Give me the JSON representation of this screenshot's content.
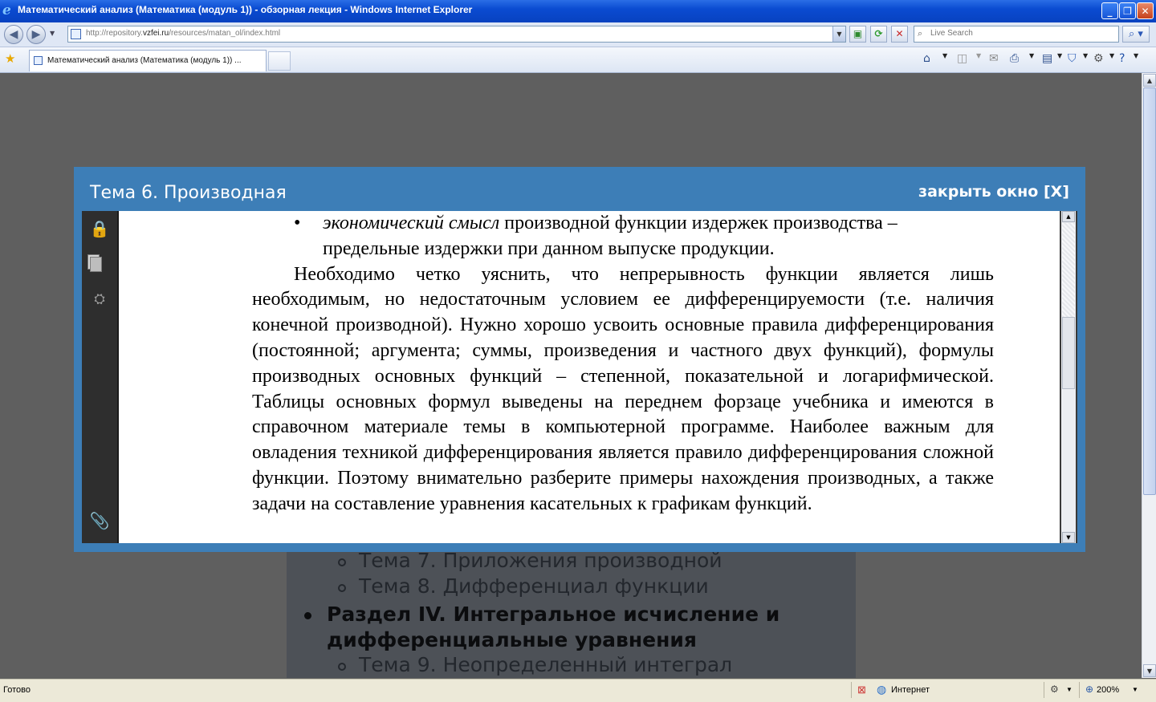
{
  "window": {
    "title": "Математический анализ (Математика (модуль 1)) - обзорная лекция - Windows Internet Explorer",
    "controls": {
      "minimize": "_",
      "maximize": "❐",
      "close": "✕"
    }
  },
  "navbar": {
    "url_prefix": "http://repository.",
    "url_domain": "vzfei.ru",
    "url_path": "/resources/matan_ol/index.html",
    "search_placeholder": "Live Search"
  },
  "tabs": [
    {
      "label": "Математический анализ (Математика (модуль 1)) ..."
    }
  ],
  "modal": {
    "title": "Тема 6. Производная",
    "close_label": "закрыть окно [X]",
    "bullet_italic": "экономический смысл",
    "bullet_text": " производной функции издержек производства – предельные издержки при данном выпуске продукции.",
    "paragraph": "Необходимо четко уяснить, что непрерывность функции является лишь необходимым, но недостаточным условием ее дифференцируемости (т.е. наличия конечной производной). Нужно хорошо усвоить основные правила дифференцирования (постоянной; аргумента; суммы, произведения и частного двух функций), формулы производных основных функций – степенной, показательной и логарифмической. Таблицы основных формул выведены на переднем форзаце учебника и имеются в справочном материале темы в компьютерной программе. Наиболее важным для овладения техникой дифференцирования является правило дифференцирования сложной функции. Поэтому внимательно разберите примеры нахождения производных, а также задачи на составление уравнения касательных к графикам функций."
  },
  "background_list": {
    "topic7": "Тема 7. Приложения производной",
    "topic8": "Тема 8. Дифференциал функции",
    "section4": "Раздел IV. Интегральное исчисление и дифференциальные уравнения",
    "topic9": "Тема 9. Неопределенный интеграл"
  },
  "status": {
    "text": "Готово",
    "zone": "Интернет",
    "zoom": "200%"
  }
}
